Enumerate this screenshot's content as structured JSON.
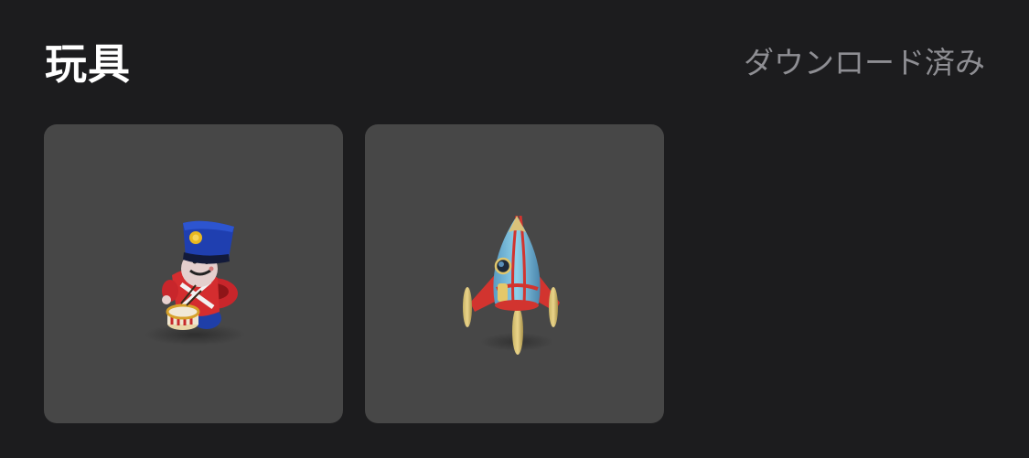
{
  "header": {
    "title": "玩具",
    "downloaded_label": "ダウンロード済み"
  },
  "items": [
    {
      "icon": "toy-drummer-soldier"
    },
    {
      "icon": "toy-tin-rocket"
    }
  ]
}
